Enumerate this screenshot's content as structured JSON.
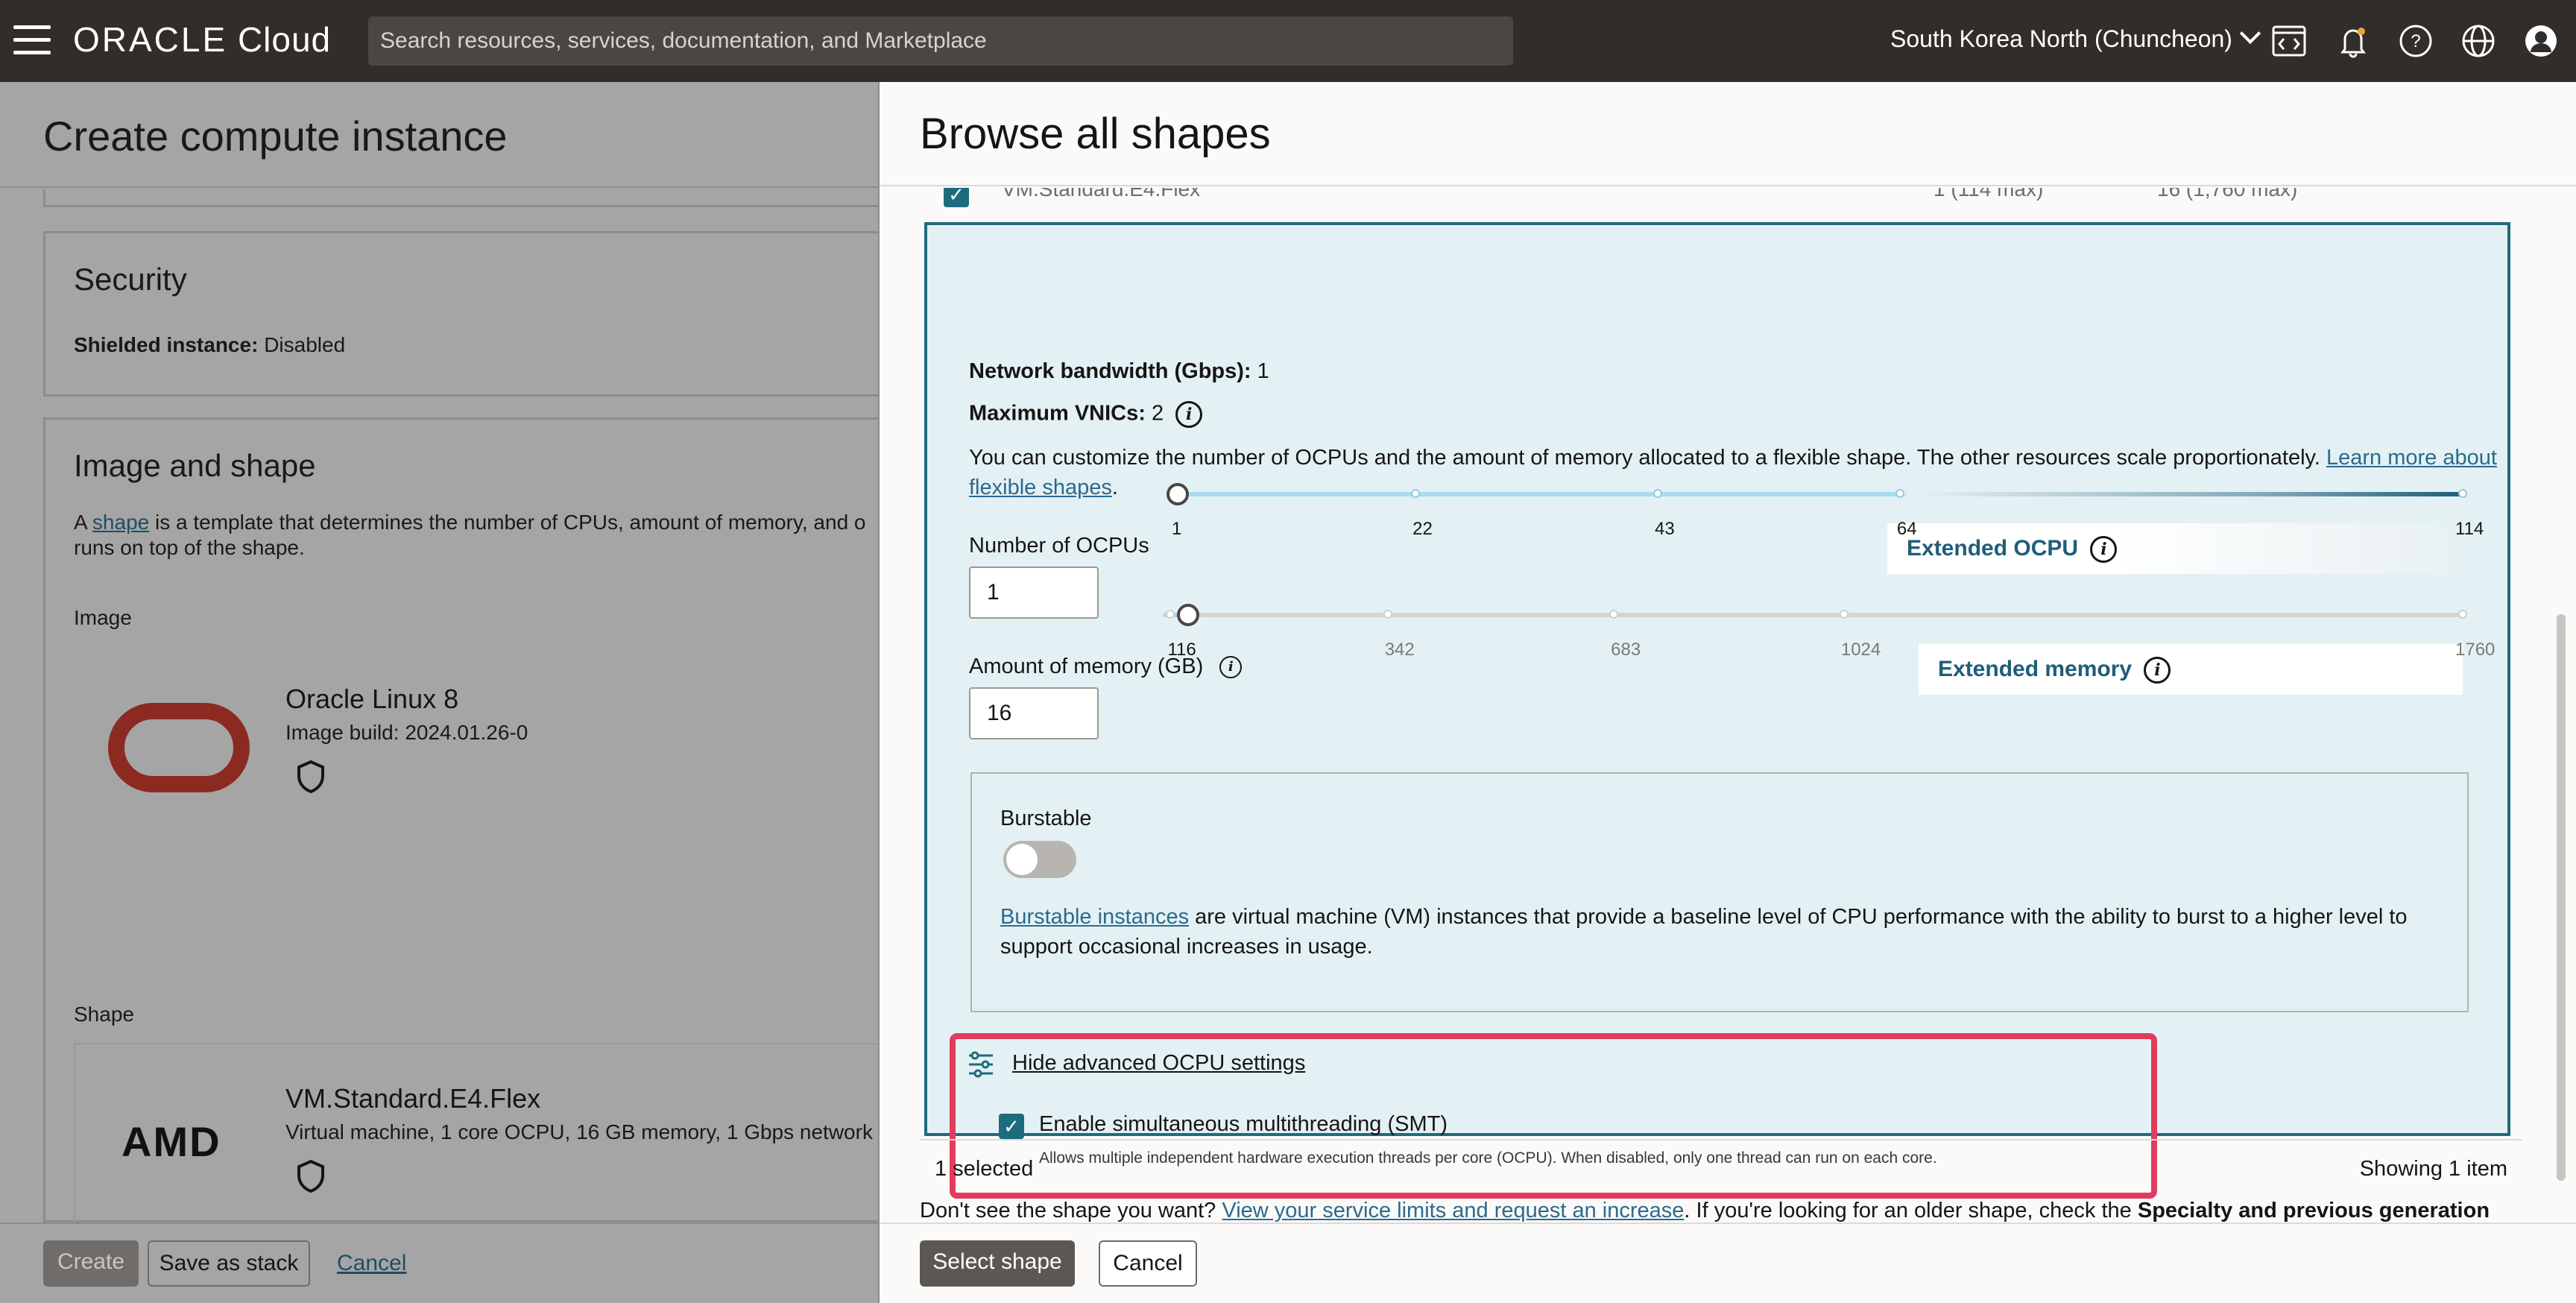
{
  "topbar": {
    "brand_main": "ORACLE",
    "brand_sub": "Cloud",
    "search_placeholder": "Search resources, services, documentation, and Marketplace",
    "region": "South Korea North (Chuncheon)"
  },
  "left_page": {
    "title": "Create compute instance",
    "security": {
      "heading": "Security",
      "shielded_label": "Shielded instance:",
      "shielded_value": "Disabled"
    },
    "image_shape": {
      "heading": "Image and shape",
      "desc_prefix": "A ",
      "desc_link": "shape",
      "desc_suffix": " is a template that determines the number of CPUs, amount of memory, and o",
      "desc_line2": "runs on top of the shape.",
      "image_label": "Image",
      "image_name": "Oracle Linux 8",
      "image_build": "Image build: 2024.01.26-0",
      "shape_label": "Shape",
      "shape_name": "VM.Standard.E4.Flex",
      "shape_desc": "Virtual machine, 1 core OCPU, 16 GB memory, 1 Gbps network",
      "amd_logo": "AMD"
    },
    "buttons": {
      "create": "Create",
      "save_stack": "Save as stack",
      "cancel": "Cancel"
    }
  },
  "panel": {
    "title": "Browse all shapes",
    "row_name": "VM.Standard.E4.Flex",
    "row_ocpu": "1 (114 max)",
    "row_mem": "16 (1,760 max)",
    "bandwidth_label": "Network bandwidth (Gbps):",
    "bandwidth_value": "1",
    "vnics_label": "Maximum VNICs:",
    "vnics_value": "2",
    "customize_text": "You can customize the number of OCPUs and the amount of memory allocated to a flexible shape. The other resources scale proportionately.",
    "learn_more_1": "Learn more about",
    "learn_more_2": "flexible shapes",
    "ocpu": {
      "label": "Number of OCPUs",
      "value": "1",
      "extended_label": "Extended OCPU",
      "ticks": [
        "1",
        "22",
        "43",
        "64",
        "114"
      ],
      "min": 1,
      "max": 114,
      "standard_max": 64,
      "current": 1
    },
    "memory": {
      "label": "Amount of memory (GB)",
      "value": "16",
      "extended_label": "Extended memory",
      "ticks": [
        "116",
        "342",
        "683",
        "1024",
        "1760"
      ],
      "min": 1,
      "max": 1760,
      "current": 16
    },
    "burstable": {
      "label": "Burstable",
      "link": "Burstable instances",
      "text_1": " are virtual machine (VM) instances that provide a baseline level of CPU performance with the ability to burst to a higher level to",
      "text_2": "support occasional increases in usage."
    },
    "advanced": {
      "link": "Hide advanced OCPU settings",
      "smt_label": "Enable simultaneous multithreading (SMT)",
      "smt_help": "Allows multiple independent hardware execution threads per core (OCPU). When disabled, only one thread can run on each core."
    },
    "selected": "1 selected",
    "showing": "Showing 1 item",
    "note_prefix": "Don't see the shape you want? ",
    "note_link": "View your service limits and request an increase",
    "note_mid": ". If you're looking for an older shape, check the ",
    "note_bold": "Specialty and previous generation",
    "buttons": {
      "select": "Select shape",
      "cancel": "Cancel"
    }
  },
  "colors": {
    "accent": "#1f6b7e",
    "highlight": "#e23b5f",
    "topbar": "#312d2a"
  }
}
